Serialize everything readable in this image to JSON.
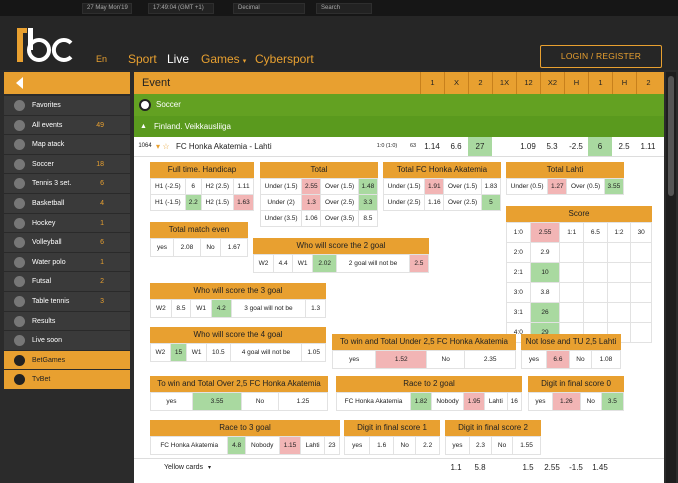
{
  "topbar": {
    "date": "27 May Mon'19",
    "time": "17:49:04 (GMT +1)",
    "odds_format": "Decimal",
    "search_placeholder": "Search"
  },
  "header": {
    "lang": "En",
    "nav": [
      "Sport",
      "Live",
      "Games",
      "Cybersport"
    ],
    "login": "LOGIN / REGISTER"
  },
  "sidebar": [
    {
      "label": "Favorites",
      "count": "",
      "icon": "star-icon"
    },
    {
      "label": "All events",
      "count": "49",
      "icon": "all-events-icon"
    },
    {
      "label": "Map atack",
      "count": "",
      "icon": "map-icon"
    },
    {
      "label": "Soccer",
      "count": "18",
      "icon": "soccer-ball-icon"
    },
    {
      "label": "Tennis 3 set.",
      "count": "6",
      "icon": "tennis-ball-icon"
    },
    {
      "label": "Basketball",
      "count": "4",
      "icon": "basketball-icon"
    },
    {
      "label": "Hockey",
      "count": "1",
      "icon": "hockey-icon"
    },
    {
      "label": "Volleyball",
      "count": "6",
      "icon": "volleyball-icon"
    },
    {
      "label": "Water polo",
      "count": "1",
      "icon": "water-polo-icon"
    },
    {
      "label": "Futsal",
      "count": "2",
      "icon": "futsal-icon"
    },
    {
      "label": "Table tennis",
      "count": "3",
      "icon": "table-tennis-icon"
    },
    {
      "label": "Results",
      "count": "",
      "icon": "results-icon"
    },
    {
      "label": "Live soon",
      "count": "",
      "icon": "live-soon-icon"
    },
    {
      "label": "BetGames",
      "count": "",
      "icon": "betgames-icon",
      "active": true
    },
    {
      "label": "TvBet",
      "count": "",
      "icon": "tvbet-icon",
      "active": true
    }
  ],
  "event": {
    "title": "Event",
    "cols": [
      "1",
      "X",
      "2",
      "1X",
      "12",
      "X2",
      "H",
      "1",
      "H",
      "2"
    ]
  },
  "sport": "Soccer",
  "league": "Finland. Veikkausliiga",
  "match": {
    "id": "1064",
    "name": "FC Honka Akatemia - Lahti",
    "score": "1:0 (1:0)",
    "more": "63",
    "odds": [
      "1.14",
      "6.6",
      "27",
      "",
      "1.09",
      "5.3",
      "-2.5",
      "6",
      "2.5",
      "1.11"
    ]
  },
  "markets": {
    "fulltime_handicap": {
      "title": "Full time. Handicap",
      "rows": [
        [
          "H1 (-2.5)",
          "6",
          "H2 (2.5)",
          "1.11"
        ],
        [
          "H1 (-1.5)",
          "2.2",
          "H2 (1.5)",
          "1.63"
        ]
      ]
    },
    "total": {
      "title": "Total",
      "rows": [
        [
          "Under (1.5)",
          "2.55",
          "Over (1.5)",
          "1.48"
        ],
        [
          "Under (2)",
          "1.3",
          "Over (2.5)",
          "3.3"
        ],
        [
          "Under (3.5)",
          "1.06",
          "Over (3.5)",
          "8.5"
        ]
      ]
    },
    "total_honka": {
      "title": "Total FC Honka Akatemia",
      "rows": [
        [
          "Under (1.5)",
          "1.91",
          "Over (1.5)",
          "1.83"
        ],
        [
          "Under (2.5)",
          "1.16",
          "Over (2.5)",
          "5"
        ]
      ]
    },
    "total_lahti": {
      "title": "Total Lahti",
      "rows": [
        [
          "Under (0.5)",
          "1.27",
          "Over (0.5)",
          "3.55"
        ]
      ]
    },
    "total_match_even": {
      "title": "Total match even",
      "row": [
        "yes",
        "2.08",
        "No",
        "1.67"
      ]
    },
    "score_2": {
      "title": "Who will score the 2 goal",
      "row": [
        "W2",
        "4.4",
        "W1",
        "2.02",
        "2 goal will not be",
        "2.5"
      ]
    },
    "score": {
      "title": "Score",
      "rows": [
        [
          "1:0",
          "2.55",
          "1:1",
          "6.5",
          "1:2",
          "30"
        ],
        [
          "2:0",
          "2.9",
          "",
          "",
          "",
          ""
        ],
        [
          "2:1",
          "10",
          "",
          "",
          "",
          ""
        ],
        [
          "3:0",
          "3.8",
          "",
          "",
          "",
          ""
        ],
        [
          "3:1",
          "26",
          "",
          "",
          "",
          ""
        ],
        [
          "4:0",
          "29",
          "",
          "",
          "",
          ""
        ]
      ]
    },
    "score_3": {
      "title": "Who will score the 3 goal",
      "row": [
        "W2",
        "8.5",
        "W1",
        "4.2",
        "3 goal will not be",
        "1.3"
      ]
    },
    "score_4": {
      "title": "Who will score the 4 goal",
      "row": [
        "W2",
        "15",
        "W1",
        "10.5",
        "4 goal will not be",
        "1.05"
      ]
    },
    "win_under": {
      "title": "To win and Total Under 2,5 FC Honka Akatemia",
      "row": [
        "yes",
        "1.52",
        "No",
        "2.35"
      ]
    },
    "not_lose": {
      "title": "Not lose and TU 2,5 Lahti",
      "row": [
        "yes",
        "6.6",
        "No",
        "1.08"
      ]
    },
    "win_over": {
      "title": "To win and Total Over 2,5 FC Honka Akatemia",
      "row": [
        "yes",
        "3.55",
        "No",
        "1.25"
      ]
    },
    "race2": {
      "title": "Race to 2 goal",
      "row": [
        "FC Honka Akatemia",
        "1.82",
        "Nobody",
        "1.95",
        "Lahti",
        "16"
      ]
    },
    "digit0": {
      "title": "Digit in final score 0",
      "row": [
        "yes",
        "1.26",
        "No",
        "3.5"
      ]
    },
    "race3": {
      "title": "Race to 3 goal",
      "row": [
        "FC Honka Akatemia",
        "4.8",
        "Nobody",
        "1.15",
        "Lahti",
        "23"
      ]
    },
    "digit1": {
      "title": "Digit in final score 1",
      "row": [
        "yes",
        "1.6",
        "No",
        "2.2"
      ]
    },
    "digit2": {
      "title": "Digit in final score 2",
      "row": [
        "yes",
        "2.3",
        "No",
        "1.55"
      ]
    }
  },
  "yellow": {
    "label": "Yellow cards",
    "odds": [
      "1.1",
      "5.8",
      "",
      "1.5",
      "2.55",
      "-1.5",
      "1.45"
    ]
  },
  "colors": {
    "accent": "#e8a030",
    "green": "#63a122",
    "up": "#a9d9a0",
    "down": "#f2b5b5"
  }
}
